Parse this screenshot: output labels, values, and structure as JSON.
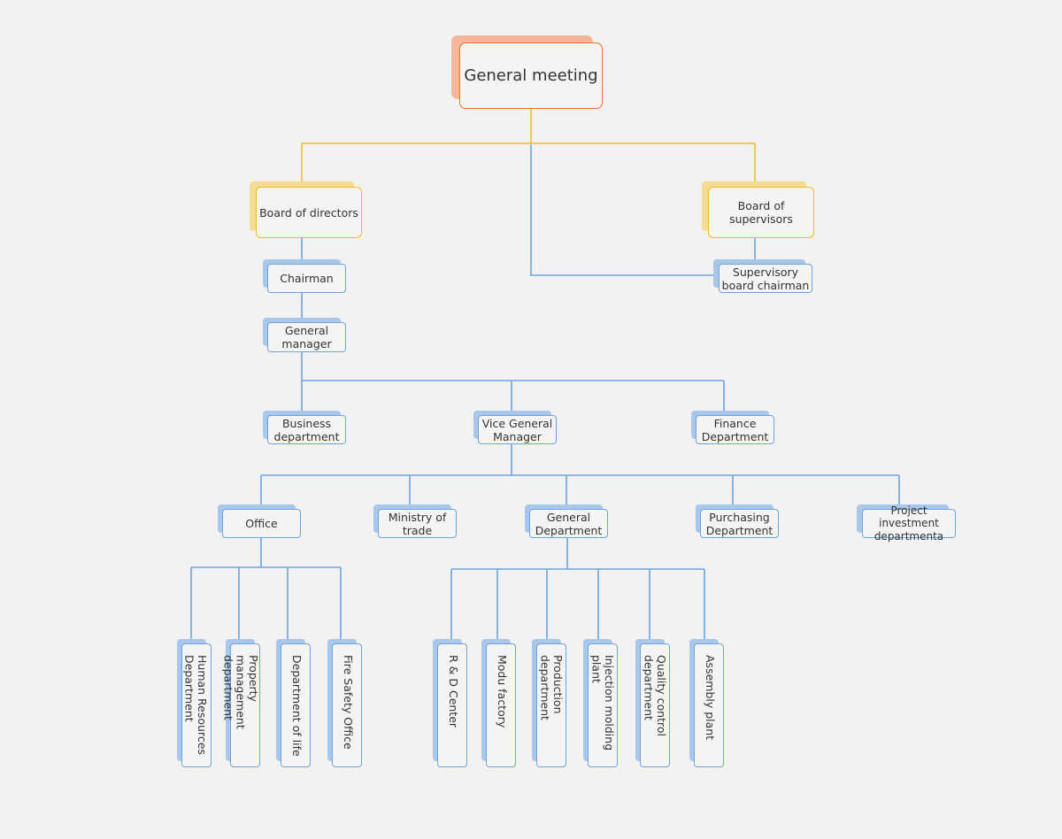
{
  "colors": {
    "background": "#f2f2f2",
    "top_accent": "#e5762e",
    "board_accent": "#f0bd1d",
    "dept_accent": "#6fa3dc",
    "connector_top": "#f0bd1d",
    "connector_main": "#6fa3dc"
  },
  "org_chart": {
    "root": {
      "label": "General meeting"
    },
    "boards": {
      "directors": {
        "label": "Board of directors"
      },
      "supervisors": {
        "label": "Board of supervisors"
      }
    },
    "chairman": {
      "label": "Chairman"
    },
    "supervisory_chairman": {
      "label": "Supervisory board chairman"
    },
    "general_manager": {
      "label": "General manager"
    },
    "level3": {
      "business": {
        "label": "Business department"
      },
      "vice_gm": {
        "label": "Vice General Manager"
      },
      "finance": {
        "label": "Finance Department"
      }
    },
    "level4": {
      "office": {
        "label": "Office"
      },
      "trade": {
        "label": "Ministry of trade"
      },
      "general_dept": {
        "label": "General Department"
      },
      "purchasing": {
        "label": "Purchasing Department"
      },
      "project": {
        "label": "Project investment departmenta"
      }
    },
    "office_children": [
      {
        "label": "Human Resources Department"
      },
      {
        "label": "Property management department"
      },
      {
        "label": "Department of life"
      },
      {
        "label": "Fire Safety Office"
      }
    ],
    "general_children": [
      {
        "label": "R & D Center"
      },
      {
        "label": "Modu factory"
      },
      {
        "label": "Production department"
      },
      {
        "label": "Injection molding plant"
      },
      {
        "label": "Quality control department"
      },
      {
        "label": "Assembly plant"
      }
    ]
  }
}
